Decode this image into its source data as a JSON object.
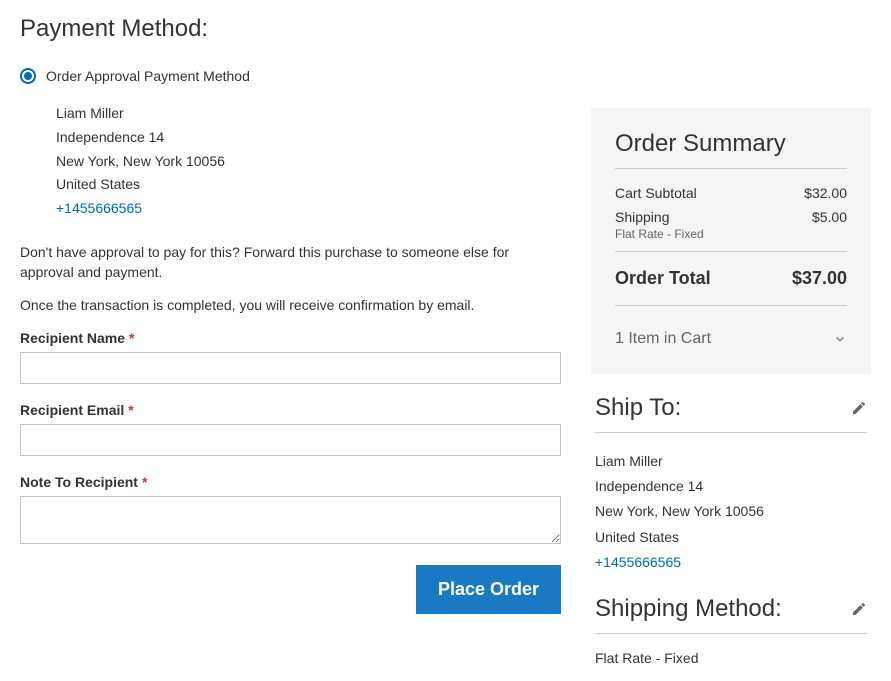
{
  "page_title": "Payment Method:",
  "payment_method": {
    "label": "Order Approval Payment Method",
    "billing": {
      "name": "Liam Miller",
      "street": "Independence 14",
      "city_region_zip": "New York, New York 10056",
      "country": "United States",
      "phone": "+1455666565"
    },
    "info1": "Don't have approval to pay for this? Forward this purchase to someone else for approval and payment.",
    "info2": "Once the transaction is completed, you will receive confirmation by email.",
    "fields": {
      "recipient_name_label": "Recipient Name",
      "recipient_email_label": "Recipient Email",
      "note_label": "Note To Recipient"
    },
    "place_order_label": "Place Order"
  },
  "summary": {
    "title": "Order Summary",
    "subtotal_label": "Cart Subtotal",
    "subtotal_value": "$32.00",
    "shipping_label": "Shipping",
    "shipping_value": "$5.00",
    "shipping_sub": "Flat Rate - Fixed",
    "total_label": "Order Total",
    "total_value": "$37.00",
    "cart_items": "1 Item in Cart"
  },
  "ship_to": {
    "title": "Ship To:",
    "name": "Liam Miller",
    "street": "Independence 14",
    "city_region_zip": "New York, New York 10056",
    "country": "United States",
    "phone": "+1455666565"
  },
  "shipping_method": {
    "title": "Shipping Method:",
    "value": "Flat Rate - Fixed"
  }
}
